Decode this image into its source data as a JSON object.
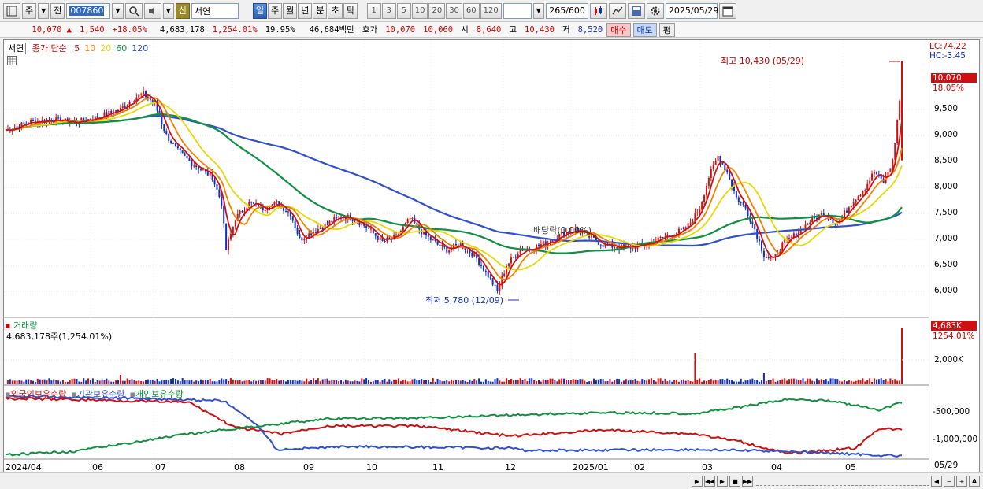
{
  "toolbar": {
    "period_label": "주",
    "prev_label": "전",
    "stock_code": "007860",
    "shin_label": "신",
    "stock_name": "서연",
    "interval_tabs": [
      "일",
      "주",
      "월",
      "년",
      "분",
      "초",
      "틱"
    ],
    "interval_selected": "일",
    "minute_options": [
      "1",
      "3",
      "5",
      "10",
      "20",
      "30",
      "60",
      "120"
    ],
    "count_value": "265",
    "count_total": "/600",
    "date_value": "2025/05/29"
  },
  "quote": {
    "price": "10,070",
    "change_arrow": "▲",
    "change": "1,540",
    "change_pct": "+18.05%",
    "volume": "4,683,178",
    "volume_pct": "1,254.01%",
    "turnover_pct": "19.95%",
    "amount": "46,684백만",
    "ask_label": "호가",
    "ask": "10,070",
    "bid": "10,060",
    "open_label": "시",
    "open": "8,640",
    "high_label": "고",
    "high": "10,430",
    "low_label": "저",
    "low": "8,520",
    "buy_label": "매수",
    "sell_label": "매도",
    "avg_label": "평"
  },
  "price_panel": {
    "stock_tag": "서연",
    "ma_title": "종가 단순",
    "ma_periods": [
      {
        "label": "5",
        "color": "#d01010"
      },
      {
        "label": "10",
        "color": "#f08000"
      },
      {
        "label": "20",
        "color": "#e8d800"
      },
      {
        "label": "60",
        "color": "#109040"
      },
      {
        "label": "120",
        "color": "#3050d0"
      }
    ],
    "lc_label": "LC:74.22",
    "hc_label": "HC:-3.45",
    "current_price_label": "10,070",
    "current_pct_label": "18.05%",
    "high_annotation": "최고 10,430 (05/29)",
    "low_annotation": "최저 5,780 (12/09)",
    "dividend_annotation": "배당락(0.00%)",
    "y_ticks": [
      "9,500",
      "9,000",
      "8,500",
      "8,000",
      "7,500",
      "7,000",
      "6,500",
      "6,000"
    ]
  },
  "volume_panel": {
    "title": "거래량",
    "info": "4,683,178주(1,254.01%)",
    "current_label": "4,683K",
    "current_pct": "1254.01%",
    "y_tick": "2,000K"
  },
  "holding_panel": {
    "legends": [
      {
        "label": "외국인보유수량",
        "color": "#d01010"
      },
      {
        "label": "기관보유수량",
        "color": "#3050d0"
      },
      {
        "label": "개인보유수량",
        "color": "#109040"
      }
    ],
    "y_ticks": [
      "-500,000",
      "-1,000,000"
    ]
  },
  "x_axis": {
    "labels": [
      "2024/04",
      "06",
      "07",
      "08",
      "09",
      "10",
      "11",
      "12",
      "2025/01",
      "02",
      "03",
      "04",
      "05"
    ],
    "right_label": "05/29"
  },
  "colors": {
    "ma5": "#d01010",
    "ma10": "#f08000",
    "ma20": "#e8d800",
    "ma60": "#109040",
    "ma120": "#3050d0",
    "up": "#d01010",
    "down": "#1030c0"
  }
}
